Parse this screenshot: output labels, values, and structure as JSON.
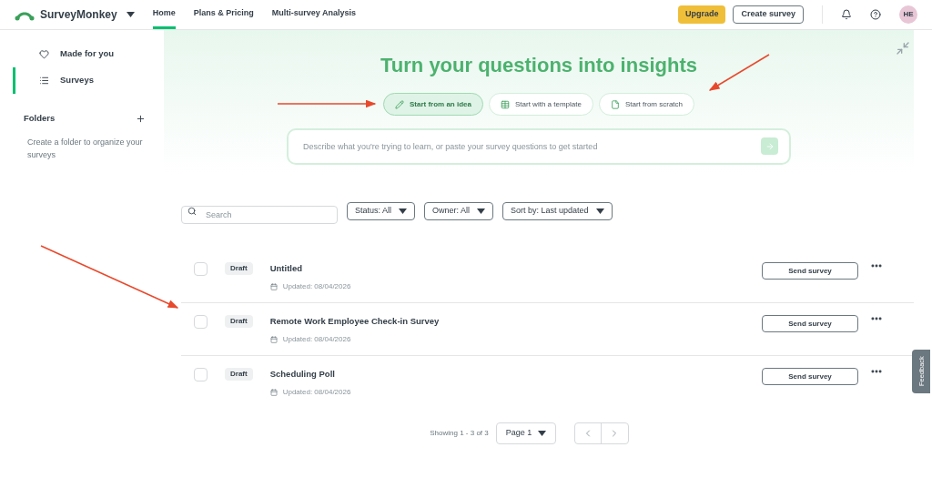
{
  "header": {
    "brand": "SurveyMonkey",
    "nav": [
      {
        "label": "Home",
        "selected": true
      },
      {
        "label": "Plans & Pricing",
        "selected": false
      },
      {
        "label": "Multi-survey Analysis",
        "selected": false
      }
    ],
    "upgrade": "Upgrade",
    "create": "Create survey",
    "avatar": "HE"
  },
  "sidebar": {
    "items": [
      {
        "label": "Made for you",
        "selected": false,
        "kind": "heart"
      },
      {
        "label": "Surveys",
        "selected": true,
        "kind": "list"
      }
    ],
    "folders_title": "Folders",
    "folders_hint": "Create a folder to organize your surveys"
  },
  "hero": {
    "title": "Turn your questions into insights",
    "actions": [
      {
        "label": "Start from an idea",
        "selected": true,
        "kind": "pencil"
      },
      {
        "label": "Start with a template",
        "selected": false,
        "kind": "grid"
      },
      {
        "label": "Start from scratch",
        "selected": false,
        "kind": "page"
      }
    ],
    "prompt_placeholder": "Describe what you're trying to learn, or paste your survey questions to get started"
  },
  "filters": {
    "search_placeholder": "Search",
    "dropdowns": [
      "Status: All",
      "Owner: All",
      "Sort by: Last updated"
    ]
  },
  "surveys": [
    {
      "checked": false,
      "status": "Draft",
      "title": "Untitled",
      "updated": "Updated: 08/04/2026",
      "action": "Send survey"
    },
    {
      "checked": false,
      "status": "Draft",
      "title": "Remote Work Employee Check-in Survey",
      "updated": "Updated: 08/04/2026",
      "action": "Send survey"
    },
    {
      "checked": false,
      "status": "Draft",
      "title": "Scheduling Poll",
      "updated": "Updated: 08/04/2026",
      "action": "Send survey"
    }
  ],
  "pagination": {
    "showing": "Showing 1 - 3 of 3",
    "page": "Page 1"
  },
  "feedback": "Feedback"
}
